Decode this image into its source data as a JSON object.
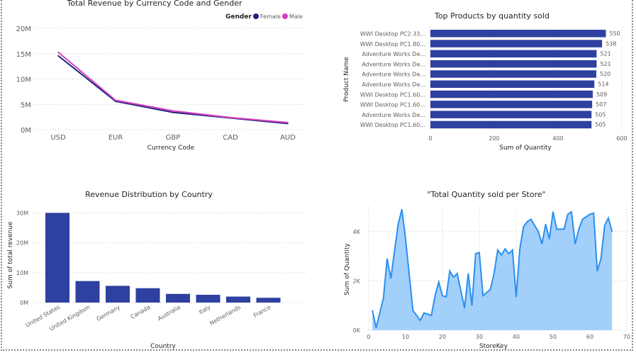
{
  "colors": {
    "bar": "#2e40a0",
    "female": "#1a237e",
    "male": "#d63fbf",
    "area_line": "#2b8ff0",
    "area_fill": "#a3d0fb"
  },
  "chart_data": [
    {
      "type": "line",
      "title": "Total Revenue by Currency Code and Gender",
      "xlabel": "Currency Code",
      "ylabel": "",
      "legend_title": "Gender",
      "legend_position": "top-right",
      "categories": [
        "USD",
        "EUR",
        "GBP",
        "CAD",
        "AUD"
      ],
      "y_ticks": [
        "0M",
        "5M",
        "10M",
        "15M",
        "20M"
      ],
      "ylim": [
        0,
        20
      ],
      "grid": true,
      "series": [
        {
          "name": "Female",
          "values": [
            14.6,
            5.6,
            3.4,
            2.3,
            1.2
          ]
        },
        {
          "name": "Male",
          "values": [
            15.3,
            5.8,
            3.7,
            2.4,
            1.4
          ]
        }
      ]
    },
    {
      "type": "bar",
      "orientation": "horizontal",
      "title": "Top Products by quantity sold",
      "xlabel": "Sum of Quantity",
      "ylabel": "Product Name",
      "categories": [
        "WWI Desktop PC2.33...",
        "WWI Desktop PC1.80...",
        "Adventure Works De...",
        "Adventure Works De...",
        "Adventure Works De...",
        "Adventure Works De...",
        "WWI Desktop PC1.60...",
        "WWI Desktop PC1.60...",
        "Adventure Works De...",
        "WWI Desktop PC1.60..."
      ],
      "values": [
        550,
        538,
        521,
        521,
        520,
        514,
        509,
        507,
        505,
        505
      ],
      "x_ticks": [
        "0",
        "200",
        "400",
        "600"
      ],
      "xlim": [
        0,
        600
      ],
      "grid": true
    },
    {
      "type": "bar",
      "title": "Revenue Distribution by Country",
      "xlabel": "Country",
      "ylabel": "Sum of total revenue",
      "categories": [
        "United States",
        "United Kingdom",
        "Germany",
        "Canada",
        "Australia",
        "Italy",
        "Netherlands",
        "France"
      ],
      "values": [
        30.0,
        7.2,
        5.6,
        4.8,
        2.9,
        2.6,
        2.0,
        1.6
      ],
      "y_ticks": [
        "0M",
        "10M",
        "20M",
        "30M"
      ],
      "ylim": [
        0,
        32
      ],
      "grid": true
    },
    {
      "type": "area",
      "title": "\"Total Quantity sold per Store\"",
      "xlabel": "StoreKey",
      "ylabel": "Sum of Quantity",
      "y_ticks": [
        "0K",
        "2K",
        "4K"
      ],
      "x_ticks": [
        "0",
        "10",
        "20",
        "30",
        "40",
        "50",
        "60",
        "70"
      ],
      "xlim": [
        0,
        70
      ],
      "ylim": [
        0,
        5000
      ],
      "grid": true,
      "x": [
        1,
        2,
        4,
        5,
        6,
        7,
        8,
        9,
        10,
        12,
        14,
        15,
        17,
        18,
        19,
        20,
        21,
        22,
        23,
        24,
        25,
        26,
        27,
        28,
        29,
        30,
        31,
        33,
        34,
        35,
        36,
        37,
        38,
        39,
        40,
        41,
        42,
        43,
        44,
        46,
        47,
        48,
        49,
        50,
        51,
        53,
        54,
        55,
        56,
        57,
        58,
        60,
        61,
        62,
        63,
        64,
        65,
        66
      ],
      "y": [
        800,
        100,
        1300,
        2900,
        2100,
        3200,
        4300,
        4900,
        3700,
        800,
        400,
        700,
        600,
        1400,
        1950,
        1400,
        1350,
        2400,
        2150,
        2300,
        1600,
        900,
        2300,
        1000,
        3100,
        3150,
        1400,
        1650,
        2300,
        3250,
        3050,
        3300,
        3100,
        3250,
        1350,
        3300,
        4200,
        4400,
        4500,
        4000,
        3500,
        4300,
        3700,
        4800,
        4100,
        4100,
        4700,
        4800,
        3500,
        4100,
        4500,
        4700,
        4750,
        2400,
        2900,
        4250,
        4550,
        4000
      ]
    }
  ]
}
